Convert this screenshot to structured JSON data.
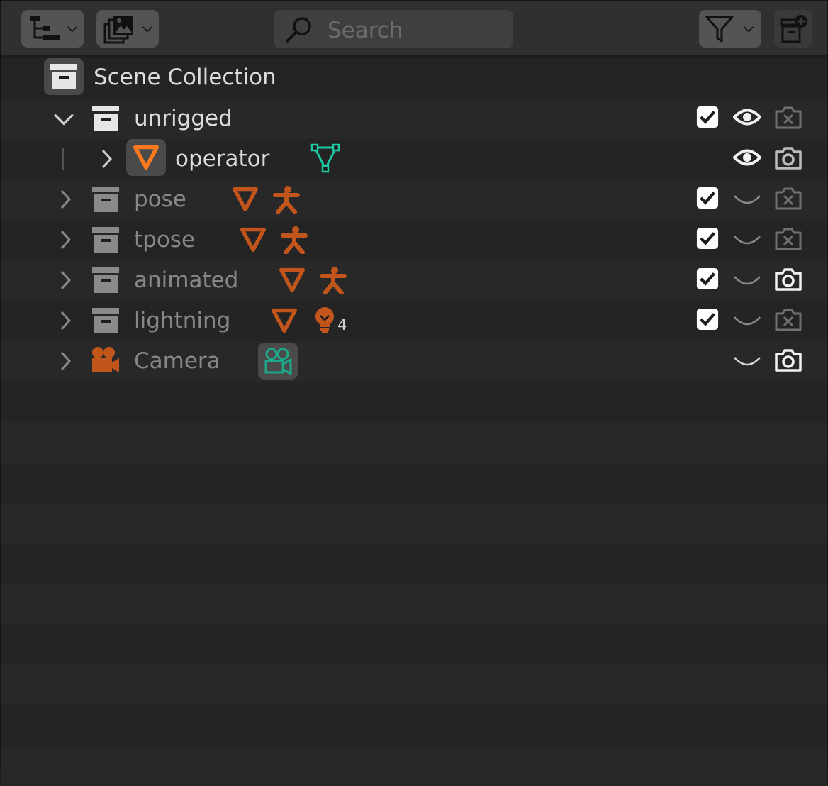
{
  "header": {
    "display_mode_icon": "outliner-tree-icon",
    "filter_mode_icon": "image-stack-icon",
    "search_placeholder": "Search",
    "filter_icon": "funnel-icon",
    "new_collection_icon": "new-collection-icon"
  },
  "tree": {
    "scene_collection": {
      "label": "Scene Collection",
      "icon": "collection-box-icon"
    },
    "rows": [
      {
        "label": "unrigged",
        "icon": "collection-box-icon",
        "expanded": true,
        "checked": true,
        "visible": true,
        "render": false
      },
      {
        "label": "operator",
        "icon": "mesh-object-icon",
        "extra_icons": [
          "mesh-data-icon"
        ],
        "visible": true,
        "render": true
      },
      {
        "label": "pose",
        "icon": "collection-box-icon",
        "extra_icons": [
          "mesh-object-icon",
          "armature-icon"
        ],
        "checked": true,
        "visible": false,
        "render": false
      },
      {
        "label": "tpose",
        "icon": "collection-box-icon",
        "extra_icons": [
          "mesh-object-icon",
          "armature-icon"
        ],
        "checked": true,
        "visible": false,
        "render": false
      },
      {
        "label": "animated",
        "icon": "collection-box-icon",
        "extra_icons": [
          "mesh-object-icon",
          "armature-icon"
        ],
        "checked": true,
        "visible": false,
        "render": true
      },
      {
        "label": "lightning",
        "icon": "collection-box-icon",
        "extra_icons": [
          "mesh-object-icon",
          "light-bulb-icon"
        ],
        "light_count": "4",
        "checked": true,
        "visible": false,
        "render": false
      },
      {
        "label": "Camera",
        "icon": "camera-object-icon",
        "extra_icons": [
          "camera-data-icon"
        ],
        "visible": false,
        "render": true
      }
    ]
  },
  "colors": {
    "object_orange": "#c2551b",
    "object_orange_active": "#ff7a1f",
    "data_green": "#1ec9a2",
    "checkbox_white": "#ffffff"
  }
}
